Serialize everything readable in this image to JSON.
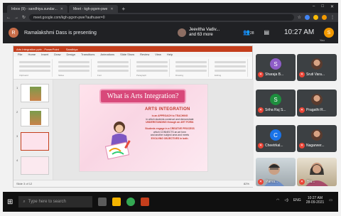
{
  "browser": {
    "tabs": [
      {
        "label": "Inbox (9) - sandhiya.sundar...",
        "active": false
      },
      {
        "label": "Meet - kgh-pgxm-pwe",
        "active": true
      }
    ],
    "url": "meet.google.com/kgh-pgxm-pwe?authuser=0",
    "window_controls": [
      "–",
      "□",
      "✕"
    ]
  },
  "meet": {
    "presenter_initial": "R",
    "presenting_text": "Ramalakshmi Dass is presenting",
    "joined_line1": "Jeevitha Vadiv...",
    "joined_line2": "and 63 more",
    "people_count": "28",
    "time": "10:27 AM",
    "you_initial": "S",
    "you_label": "You"
  },
  "ppt": {
    "title": "Arts Integration.pptx - PowerPoint",
    "title_tab": "Sandhiya",
    "menu": [
      "File",
      "Home",
      "Insert",
      "Draw",
      "Design",
      "Transitions",
      "Animations",
      "Slide Show",
      "Review",
      "View",
      "Help"
    ],
    "ribbon_groups": [
      "Clipboard",
      "Slides",
      "Font",
      "Paragraph",
      "Drawing",
      "Editing"
    ],
    "slide_numbers": [
      "1",
      "2",
      "3",
      "4"
    ],
    "status_left": "Slide 3 of 12",
    "status_right": "82%",
    "slide": {
      "title": "What is Arts Integration?",
      "heading": "ARTS INTEGRATION",
      "lines": [
        {
          "text": "is an APPROACH to TEACHING",
          "highlight": true
        },
        {
          "text": "in which students construct and demonstrate",
          "highlight": false
        },
        {
          "text": "UNDERSTANDING through an ART FORM.",
          "highlight": true
        },
        {
          "text": "",
          "highlight": false
        },
        {
          "text": "Students engage in a CREATIVE PROCESS",
          "highlight": true
        },
        {
          "text": "which CONNECTS an art form",
          "highlight": false
        },
        {
          "text": "and another subject area and meets",
          "highlight": false
        },
        {
          "text": "EVOLVING OBJECTIVES in both.",
          "highlight": true
        }
      ]
    }
  },
  "participants": [
    {
      "name": "Sharaja B...",
      "initial": "S",
      "color": "#8e5cc7",
      "photo": false
    },
    {
      "name": "Sruti Vara...",
      "initial": "",
      "color": "",
      "photo": true
    },
    {
      "name": "Sriha Raj S...",
      "initial": "S",
      "color": "#1e8e3e",
      "photo": false
    },
    {
      "name": "Pragathi R...",
      "initial": "",
      "color": "",
      "photo": true
    },
    {
      "name": "Cheetrkal...",
      "initial": "C",
      "color": "#1a73e8",
      "photo": false
    },
    {
      "name": "Nagarwer...",
      "initial": "",
      "color": "",
      "photo": true
    }
  ],
  "videos": [
    {
      "name": "Parva..."
    },
    {
      "name": "Blu..."
    }
  ],
  "taskbar": {
    "search_placeholder": "Type here to search",
    "lang": "ENG",
    "time": "10:27 AM",
    "date": "28-09-2021"
  }
}
